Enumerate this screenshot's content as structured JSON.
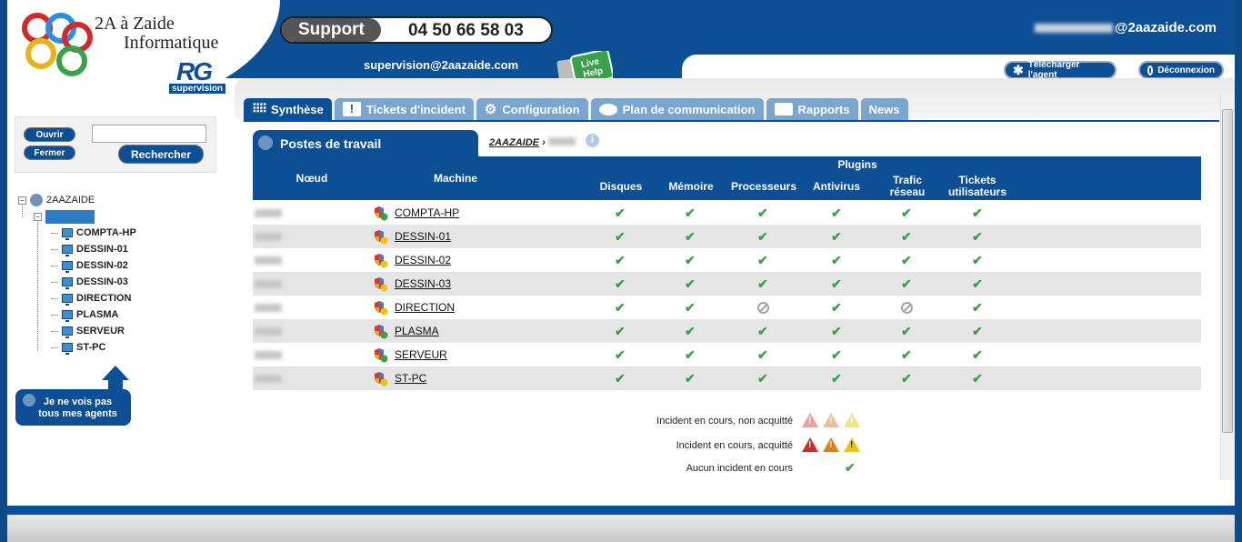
{
  "brand": {
    "line1": "2A à Zaide",
    "line2": "Informatique",
    "rg_letters": "RG",
    "rg_sub": "supervision"
  },
  "support": {
    "label": "Support",
    "phone": "04 50 66 58 03"
  },
  "header": {
    "email": "supervision@2aazaide.com",
    "live_help": "Live Help",
    "user_email_suffix": "@2aazaide.com",
    "download_agent": "Télécharger l'agent",
    "logout": "Déconnexion"
  },
  "tabs": [
    {
      "label": "Synthèse",
      "icon": "grid-icon"
    },
    {
      "label": "Tickets d'incident",
      "icon": "exclamation-icon"
    },
    {
      "label": "Configuration",
      "icon": "gears-icon"
    },
    {
      "label": "Plan de communication",
      "icon": "speech-bubble-icon"
    },
    {
      "label": "Rapports",
      "icon": "report-icon"
    },
    {
      "label": "News",
      "icon": ""
    }
  ],
  "left": {
    "open_label": "Ouvrir",
    "close_label": "Fermer",
    "search_value": "",
    "search_label": "Rechercher",
    "tree_root": "2AAZAIDE",
    "tree_items": [
      "COMPTA-HP",
      "DESSIN-01",
      "DESSIN-02",
      "DESSIN-03",
      "DIRECTION",
      "PLASMA",
      "SERVEUR",
      "ST-PC"
    ],
    "agents_note_line1": "Je ne vois pas",
    "agents_note_line2": "tous mes agents"
  },
  "main": {
    "section_title": "Postes de travail",
    "breadcrumb_root": "2AAZAIDE",
    "breadcrumb_sep": "›",
    "headers": {
      "node": "Nœud",
      "machine": "Machine",
      "plugins": "Plugins",
      "disks": "Disques",
      "memory": "Mémoire",
      "cpu": "Processeurs",
      "antivirus": "Antivirus",
      "traffic_line1": "Trafic",
      "traffic_line2": "réseau",
      "tickets_line1": "Tickets",
      "tickets_line2": "utilisateurs"
    },
    "rows": [
      {
        "machine": "COMPTA-HP",
        "shield": "ok",
        "status": [
          "ok",
          "ok",
          "ok",
          "ok",
          "ok",
          "ok"
        ]
      },
      {
        "machine": "DESSIN-01",
        "shield": "warn",
        "status": [
          "ok",
          "ok",
          "ok",
          "ok",
          "ok",
          "ok"
        ]
      },
      {
        "machine": "DESSIN-02",
        "shield": "warn",
        "status": [
          "ok",
          "ok",
          "ok",
          "ok",
          "ok",
          "ok"
        ]
      },
      {
        "machine": "DESSIN-03",
        "shield": "warn",
        "status": [
          "ok",
          "ok",
          "ok",
          "ok",
          "ok",
          "ok"
        ]
      },
      {
        "machine": "DIRECTION",
        "shield": "warn",
        "status": [
          "ok",
          "ok",
          "na",
          "ok",
          "na",
          "ok"
        ]
      },
      {
        "machine": "PLASMA",
        "shield": "ok",
        "status": [
          "ok",
          "ok",
          "ok",
          "ok",
          "ok",
          "ok"
        ]
      },
      {
        "machine": "SERVEUR",
        "shield": "ok",
        "status": [
          "ok",
          "ok",
          "ok",
          "ok",
          "ok",
          "ok"
        ]
      },
      {
        "machine": "ST-PC",
        "shield": "warn",
        "status": [
          "ok",
          "ok",
          "ok",
          "ok",
          "ok",
          "ok"
        ]
      }
    ],
    "legend": {
      "unack": "Incident en cours, non acquitté",
      "ack": "Incident en cours, acquitté",
      "none": "Aucun incident en cours"
    }
  },
  "colors": {
    "primary": "#0d4f94",
    "tab_inactive": "#79a5cf",
    "ok": "#3aa14a"
  }
}
